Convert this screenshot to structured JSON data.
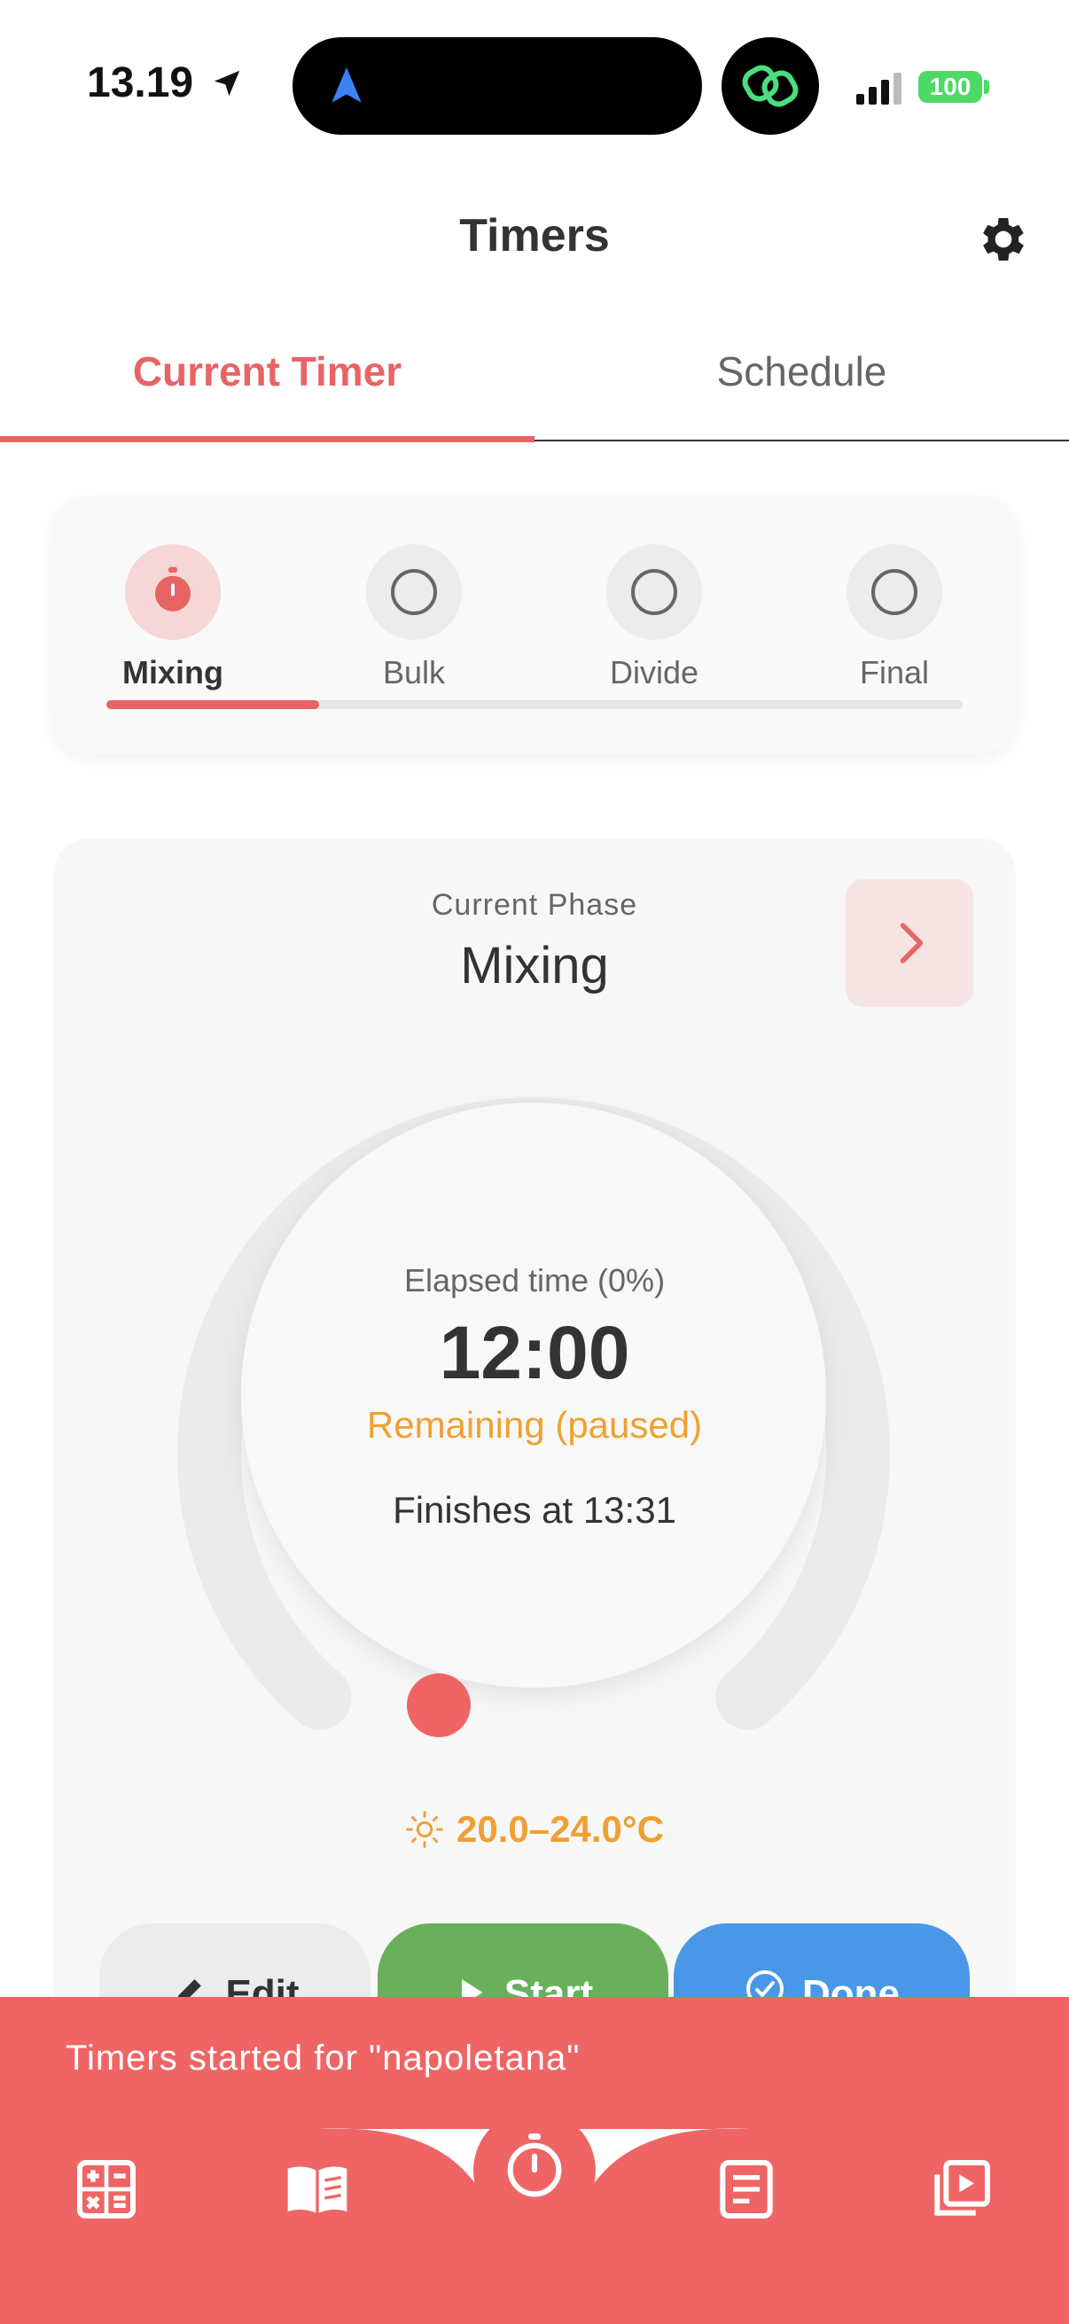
{
  "status": {
    "time": "13.19",
    "battery": "100"
  },
  "header": {
    "title": "Timers"
  },
  "tabs": [
    {
      "label": "Current Timer"
    },
    {
      "label": "Schedule"
    }
  ],
  "phases": [
    {
      "label": "Mixing"
    },
    {
      "label": "Bulk"
    },
    {
      "label": "Divide"
    },
    {
      "label": "Final"
    }
  ],
  "phase_card": {
    "caption": "Current Phase",
    "name": "Mixing",
    "elapsed_label": "Elapsed time (0%)",
    "time": "12:00",
    "remaining_label": "Remaining (paused)",
    "finishes": "Finishes at 13:31",
    "progress": 0,
    "temperature": "20.0–24.0°C"
  },
  "actions": {
    "edit": "Edit",
    "start": "Start",
    "done": "Done"
  },
  "toast": {
    "message": "Timers started for \"napoletana\""
  },
  "colors": {
    "accent": "#e86464",
    "warning": "#f0a032",
    "start": "#6ab05c",
    "done": "#4a97e8"
  }
}
